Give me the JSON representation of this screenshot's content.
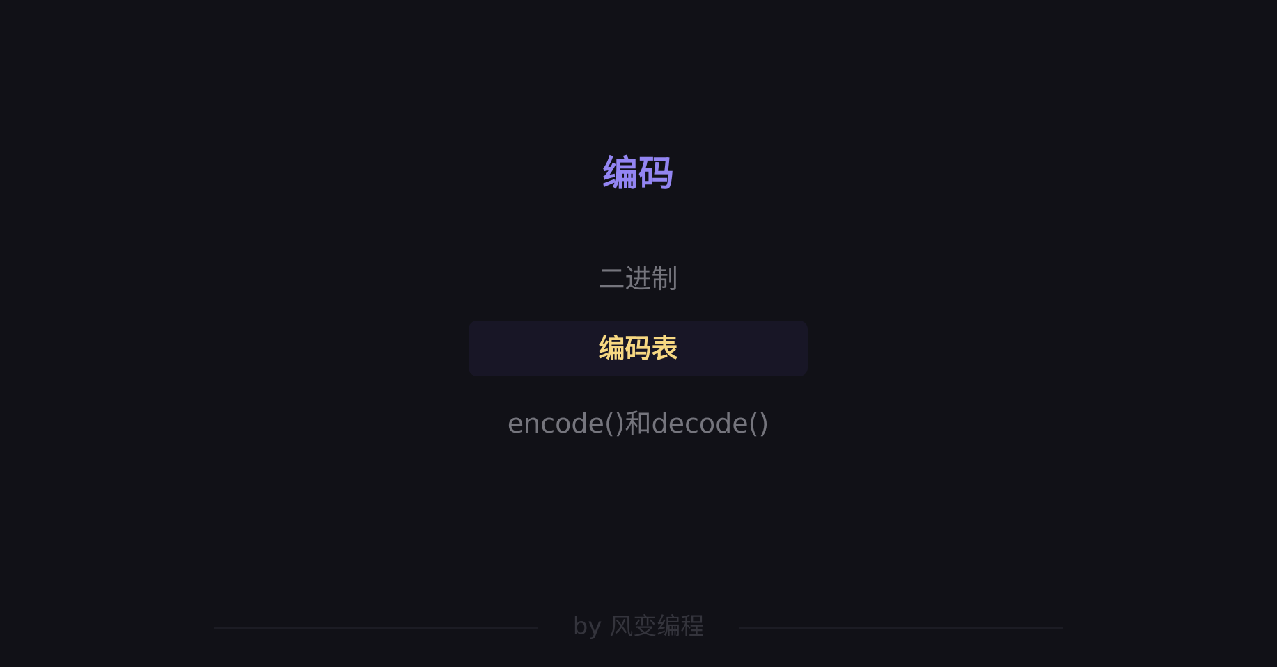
{
  "title": "编码",
  "menu": {
    "items": [
      {
        "label": "二进制",
        "active": false
      },
      {
        "label": "编码表",
        "active": true
      },
      {
        "label": "encode()和decode()",
        "active": false
      }
    ]
  },
  "footer": {
    "text": "by 风变编程"
  },
  "colors": {
    "background": "#111117",
    "title": "#9385f2",
    "active_text": "#f7d882",
    "active_background": "#181626",
    "inactive_text": "#75757d",
    "footer_text": "#34343c"
  }
}
